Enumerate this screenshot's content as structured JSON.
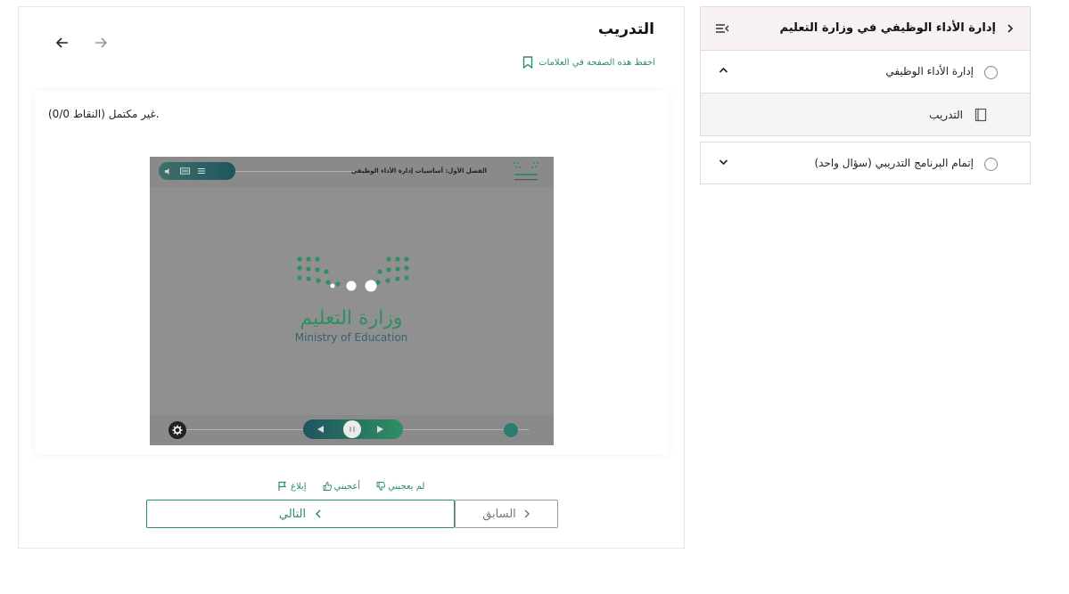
{
  "header": {
    "title": "التدريب",
    "bookmark_label": "احفظ هذه الصفحة في العلامات"
  },
  "content": {
    "score_text": "(0/0 النقاط) غير مكتمل.",
    "video": {
      "chapter_title": "الفصل الأول: أساسيات إدارة الأداء الوظيفي",
      "logo_ar": "وزارة التعليم",
      "logo_en": "Ministry of Education"
    }
  },
  "feedback": {
    "dislike_label": "لم يعجبني",
    "like_label": "أعجبني",
    "report_label": "إبلاغ"
  },
  "pager": {
    "next_label": "التالي",
    "prev_label": "السابق"
  },
  "sidebar": {
    "course_title": "إدارة الأداء الوظيفي في وزارة التعليم",
    "sections": [
      {
        "title": "إدارة الأداء الوظيفي",
        "lessons": [
          {
            "title": "التدريب"
          }
        ]
      },
      {
        "title": "إتمام البرنامج التدريبي (سؤال واحد)"
      }
    ]
  },
  "colors": {
    "accent": "#2a8a7a",
    "header_bg": "#f7f1f1",
    "video_bg": "#909090",
    "brand_green": "#2f8f63"
  },
  "icons": [
    "arrow-left-icon",
    "arrow-right-icon",
    "bookmark-icon",
    "volume-icon",
    "keyboard-icon",
    "list-icon",
    "gear-icon",
    "play-icon",
    "pause-icon",
    "thumb-down-icon",
    "thumb-up-icon",
    "flag-icon",
    "chevron-left-icon",
    "chevron-right-icon",
    "chevron-up-icon",
    "chevron-down-icon",
    "menu-collapse-icon",
    "book-icon"
  ]
}
